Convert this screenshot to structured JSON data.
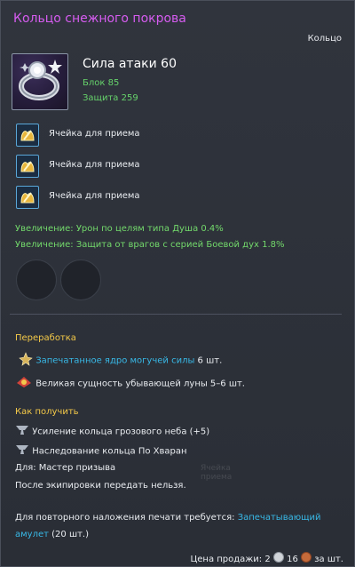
{
  "item": {
    "title": "Кольцо снежного покрова",
    "type": "Кольцо",
    "attack": "Сила атаки 60",
    "block": "Блок 85",
    "defense": "Защита 259"
  },
  "slots": [
    {
      "label": "Ячейка для приема"
    },
    {
      "label": "Ячейка для приема"
    },
    {
      "label": "Ячейка для приема"
    }
  ],
  "bonuses": [
    "Увеличение: Урон по целям типа Душа 0.4%",
    "Увеличение: Защита от врагов с серией Боевой дух 1.8%"
  ],
  "upgrade": {
    "title": "Переработка",
    "mat1_name": "Запечатанное ядро могучей силы",
    "mat1_qty": " 6 шт.",
    "mat2": "Великая сущность убывающей луны 5–6 шт."
  },
  "obtain": {
    "title": "Как получить",
    "way1": "Усиление кольца грозового неба (+5)",
    "way2": "Наследование кольца По Хваран"
  },
  "restrictions": {
    "class": "Для: Мастер призыва",
    "bind": "После экипировки передать нельзя."
  },
  "reseal": {
    "prefix": "Для повторного наложения печати требуется: ",
    "item_a": "Запечатывающий",
    "item_b": "амулет",
    "qty": " (20 шт.)"
  },
  "faded_text": "Ячейка приема",
  "price": {
    "label": "Цена продажи: ",
    "gold": "2",
    "silver": "16",
    "suffix": " за шт."
  },
  "colors": {
    "title": "#d65cf0",
    "stat_green": "#66d36b",
    "section": "#f4c948",
    "link": "#38b8e6"
  }
}
